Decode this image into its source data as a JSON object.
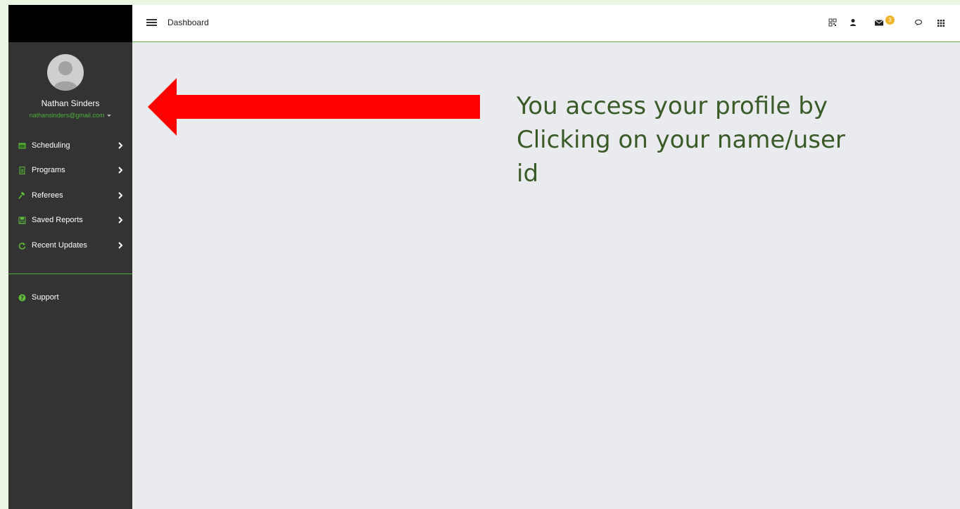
{
  "header": {
    "title": "Dashboard",
    "notification_count": "3",
    "icons": [
      "qr-code-icon",
      "user-icon",
      "envelope-icon",
      "chat-icon",
      "apps-grid-icon"
    ]
  },
  "user": {
    "name": "Nathan Sinders",
    "email": "nathansinders@gmail.com"
  },
  "sidebar": {
    "items": [
      {
        "label": "Scheduling",
        "icon": "calendar-icon"
      },
      {
        "label": "Programs",
        "icon": "document-icon"
      },
      {
        "label": "Referees",
        "icon": "gavel-icon"
      },
      {
        "label": "Saved Reports",
        "icon": "save-icon"
      },
      {
        "label": "Recent Updates",
        "icon": "refresh-icon"
      }
    ],
    "support": {
      "label": "Support",
      "icon": "question-circle-icon"
    }
  },
  "annotation": {
    "text": "You access your profile by Clicking on your name/user id",
    "arrow_color": "#ff0000",
    "text_color": "#3a5a28"
  },
  "colors": {
    "sidebar_bg": "#333333",
    "accent": "#4cae3c",
    "content_bg": "#eaebee",
    "badge": "#f0b429"
  }
}
